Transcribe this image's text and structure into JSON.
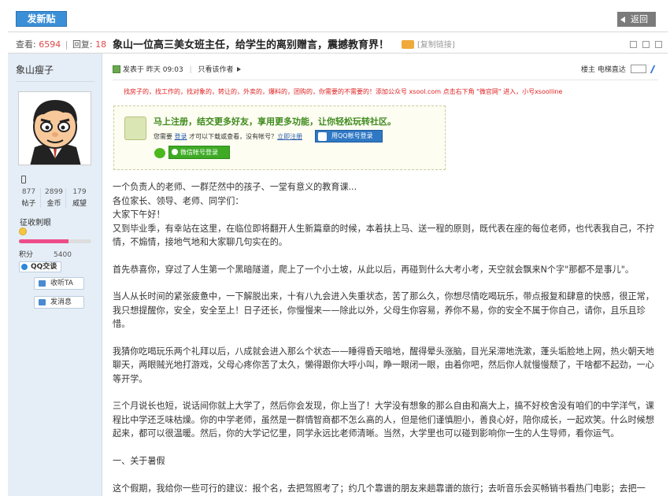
{
  "header": {
    "post_button": "发新贴",
    "back_button": "返回"
  },
  "thread": {
    "views_label": "查看:",
    "views": "6594",
    "replies_label": "回复:",
    "replies": "18",
    "title": "象山一位高三美女班主任，给学生的离别赠言，震撼教育界！",
    "copy_link": "[复制链接]"
  },
  "author": {
    "name": "象山瘦子",
    "stats": [
      {
        "value": "877",
        "label": "帖子"
      },
      {
        "value": "2899",
        "label": "金币"
      },
      {
        "value": "179",
        "label": "威望"
      }
    ],
    "rank": "征收刺眼",
    "progress": 0.68,
    "points_label": "积分",
    "points": "5400",
    "qq_label": "QQ交谈",
    "add_friend": "收听TA",
    "send_message": "发消息"
  },
  "post": {
    "posted_label": "发表于",
    "posted_time": "昨天 09:03",
    "author_only": "只看该作者",
    "floor_label": "楼主",
    "jump_label": "电梯直达",
    "ad_line": "找房子的，找工作的，找对象的，转让的，外卖的，爆料的，团购的，你需要的不需要的！添加公众号 xsool.com   点击右下角 \"微官网\" 进入，小号xsoolline",
    "login": {
      "title": "马上注册，结交更多好友，享用更多功能，让你轻松玩转社区。",
      "sub_prefix": "您需要",
      "login_link": "登录",
      "sub_mid": "才可以下载或查看，没有帐号？",
      "register_link": "立即注册",
      "qq_button": "用QQ帐号登录",
      "wechat_button": "微信帐号登录"
    },
    "paragraphs": [
      "一个负责人的老师、一群茫然中的孩子、一堂有意义的教育课...",
      "各位家长、领导、老师、同学们：",
      "大家下午好！",
      "又到毕业季，有幸站在这里，在临位即将翻开人生新篇章的时候，本着扶上马、送一程的原则，既代表在座的每位老师，也代表我自己，不拧情，不煽情，接地气地和大家聊几句实在的。",
      "首先恭喜你，穿过了人生第一个黑暗隧道，爬上了一个小土坡，从此以后，再碰到什么大考小考，天空就会飘来N个字\"那都不是事儿\"。",
      "当人从长时间的紧张疲惫中，一下解脱出来，十有八九会进入失重状态，苦了那么久，你想尽情吃喝玩乐，带点报复和肆意的快感，很正常，我只想提醒你，安全，安全至上！日子还长，你慢慢来——除此以外，父母生你容易，养你不易，你的安全不属于你自己，请你，且乐且珍惜。",
      "我猜你吃喝玩乐两个礼拜以后，八成就会进入那么个状态——睡得昏天暗地，醒得晕头涨脑，目光呆滞地洗漱，蓬头垢脸地上网，热火朝天地聊天，两眼贼光地打游戏，父母心疼你苦了太久，懒得跟你大呼小叫，睁一眼闭一眼，由着你吧，然后你人就慢慢颓了，干啥都不起劲，一心等开学。",
      "三个月说长也短，说话间你就上大学了，然后你会发现，你上当了！大学没有想象的那么自由和高大上，搞不好校舍没有咱们的中学洋气，课程比中学还乏味枯燥。你的中学老师，虽然是一群情智商都不怎么高的人，但是他们谨慎胆小，善良心好，陪你成长，一起欢笑。什么时候想起来，都可以很温暖。然后，你的大学记忆里，同学永远比老师清晰。当然，大学里也可以碰到影响你一生的人生导师，看你运气。",
      "一、关于暑假",
      "这个假期，我给你一些可行的建议：报个名，去把驾照考了；约几个靠谱的朋友来趟靠谱的旅行；去听音乐会买畅销书看热门电影；去把一"
    ]
  }
}
